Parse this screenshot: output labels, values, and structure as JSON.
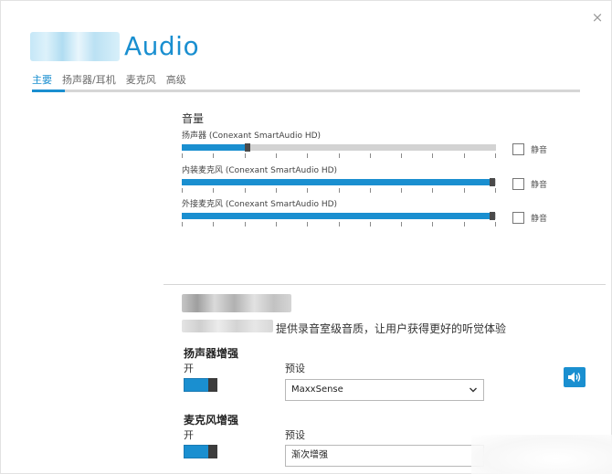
{
  "window": {
    "title": "Audio",
    "close_label": "×"
  },
  "tabs": [
    {
      "label": "主要",
      "active": true
    },
    {
      "label": "扬声器/耳机",
      "active": false
    },
    {
      "label": "麦克风",
      "active": false
    },
    {
      "label": "高级",
      "active": false
    }
  ],
  "volume": {
    "title": "音量",
    "devices": [
      {
        "label": "扬声器 (Conexant SmartAudio HD)",
        "level_percent": 20,
        "mute_label": "静音",
        "muted": false
      },
      {
        "label": "内装麦克风 (Conexant SmartAudio HD)",
        "level_percent": 98,
        "mute_label": "静音",
        "muted": false
      },
      {
        "label": "外接麦克风 (Conexant SmartAudio HD)",
        "level_percent": 98,
        "mute_label": "静音",
        "muted": false
      }
    ]
  },
  "enhancement": {
    "description": "提供录音室级音质，让用户获得更好的听觉体验",
    "speaker": {
      "title": "扬声器增强",
      "state_label": "开",
      "preset_label": "预设",
      "preset_value": "MaxxSense"
    },
    "mic": {
      "title": "麦克风增强",
      "state_label": "开",
      "preset_label": "预设",
      "preset_value": "渐次增强"
    }
  },
  "colors": {
    "accent": "#1a8fd0",
    "track": "#d3d3d3",
    "thumb": "#4a4a4a"
  },
  "icons": {
    "close": "close-icon",
    "speaker_test": "speaker-volume-icon",
    "dropdown": "chevron-down-icon"
  }
}
